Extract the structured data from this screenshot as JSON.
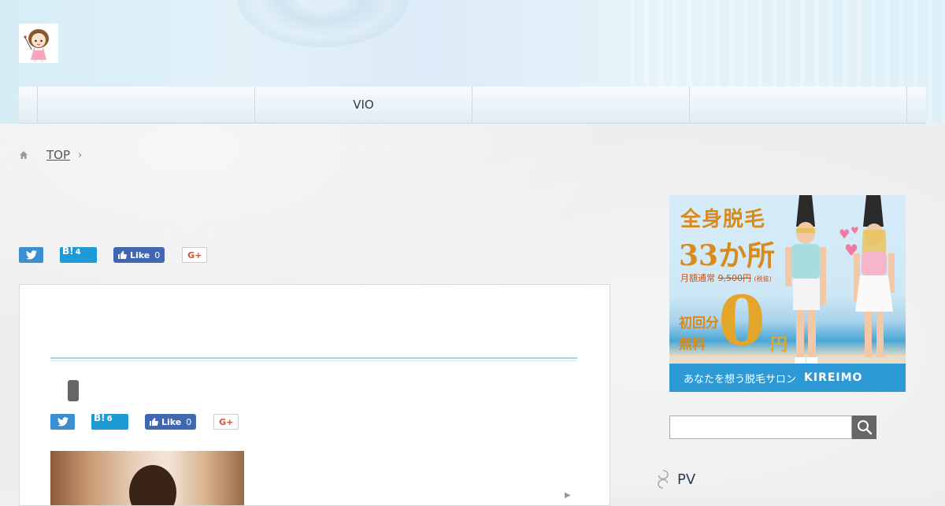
{
  "nav": {
    "items": [
      "",
      "",
      "VIO",
      "",
      "",
      ""
    ]
  },
  "breadcrumb": {
    "home_label": "TOP"
  },
  "share_top": {
    "hatena_count": "4",
    "fb_label": "Like",
    "fb_count": "0",
    "hatena_icon": "B!",
    "gplus_icon": "G+"
  },
  "share_card": {
    "hatena_count": "6",
    "fb_label": "Like",
    "fb_count": "0",
    "hatena_icon": "B!",
    "gplus_icon": "G+"
  },
  "ad": {
    "line1": "全身脱毛",
    "line2": "33か所",
    "line3_prefix": "月額通常",
    "line3_price": "9,500円",
    "line3_suffix": "(税抜)",
    "line4a": "初回分",
    "line4b": "無料",
    "zero": "0",
    "yen": "円",
    "footer_text": "あなたを想う脱毛サロン",
    "brand": "KIREIMO"
  },
  "search": {
    "placeholder": ""
  },
  "sidebar": {
    "pv_title": "PV"
  },
  "colors": {
    "twitter": "#3a8fd0",
    "hatena": "#1d9bd6",
    "facebook": "#4267b2",
    "gplus": "#dd4b39"
  }
}
